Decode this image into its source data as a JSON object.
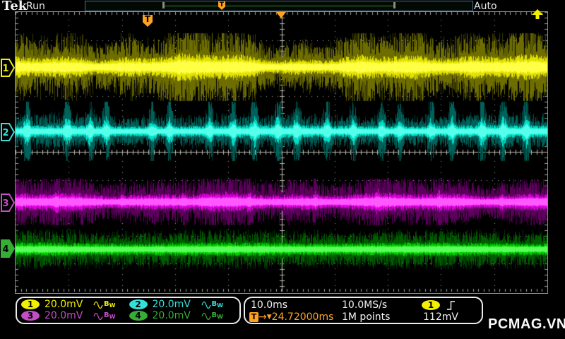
{
  "header": {
    "brand": "Tek",
    "acquisition_state": "Run",
    "trigger_mode": "Auto"
  },
  "trigger": {
    "position_label": "T",
    "arrow": "→",
    "delay_marker": "▼",
    "delay_time": "24.72000ms",
    "source": "1",
    "slope": "rising-edge",
    "level": "112mV",
    "color": "#ffa21f"
  },
  "horizontal": {
    "time_per_div": "10.0ms",
    "sample_rate": "10.0MS/s",
    "record_length": "1M points"
  },
  "channels": [
    {
      "number": "1",
      "scale": "20.0mV",
      "color": "#f0f000",
      "marker_style": "outline",
      "coupling": "ac",
      "bandwidth_label": "B",
      "bandwidth_sub": "W"
    },
    {
      "number": "2",
      "scale": "20.0mV",
      "color": "#35e0d8",
      "marker_style": "outline",
      "coupling": "ac",
      "bandwidth_label": "B",
      "bandwidth_sub": "W"
    },
    {
      "number": "3",
      "scale": "20.0mV",
      "color": "#c44ec4",
      "marker_style": "outline",
      "coupling": "ac",
      "bandwidth_label": "B",
      "bandwidth_sub": "W"
    },
    {
      "number": "4",
      "scale": "20.0mV",
      "color": "#35ae35",
      "marker_style": "filled",
      "coupling": "ac",
      "bandwidth_label": "B",
      "bandwidth_sub": "W"
    }
  ],
  "watermark": "PCMAG.VN",
  "waveforms": {
    "grid_color": "#9aa29a",
    "center_line_color": "#b8b8ae",
    "channels": [
      {
        "center": 78,
        "core": 14,
        "fuzz": 30,
        "halo": 40,
        "max_amp": 48,
        "bright": "#ffff45",
        "mid": "#e2e200",
        "dim": "#6e6e00",
        "halo_color": "#3a3a00",
        "seed": 11,
        "env": [
          [
            0.2,
            37,
            0.5
          ],
          [
            0.14,
            13,
            2.1
          ],
          [
            0.16,
            61,
            4.0
          ]
        ],
        "bursts": [],
        "burst_gain": 1
      },
      {
        "center": 169,
        "core": 8,
        "fuzz": 15,
        "halo": 20,
        "max_amp": 42,
        "bright": "#55ffe9",
        "mid": "#00ddc8",
        "dim": "#00625a",
        "halo_color": "#003b36",
        "seed": 22,
        "env": [
          [
            0.1,
            53,
            1.0
          ]
        ],
        "bursts": [
          16,
          73,
          105,
          128,
          193,
          218,
          274,
          308,
          338,
          371,
          398,
          441,
          478,
          518,
          543,
          588,
          618,
          660,
          690,
          723
        ],
        "burst_gain": 2.7
      },
      {
        "center": 269,
        "core": 11,
        "fuzz": 22,
        "halo": 28,
        "max_amp": 33,
        "bright": "#ff58ff",
        "mid": "#dd00dd",
        "dim": "#5e005e",
        "halo_color": "#370037",
        "seed": 33,
        "env": [
          [
            0.15,
            41,
            0.8
          ],
          [
            0.12,
            17,
            3.0
          ]
        ],
        "bursts": [
          58,
          150,
          238,
          330,
          424,
          512,
          600,
          688
        ],
        "burst_gain": 1.5
      },
      {
        "center": 336,
        "core": 9,
        "fuzz": 17,
        "halo": 23,
        "max_amp": 28,
        "bright": "#58ff58",
        "mid": "#00cc00",
        "dim": "#005e00",
        "halo_color": "#003200",
        "seed": 44,
        "env": [
          [
            0.07,
            47,
            1.6
          ]
        ],
        "bursts": [],
        "burst_gain": 1
      }
    ]
  }
}
